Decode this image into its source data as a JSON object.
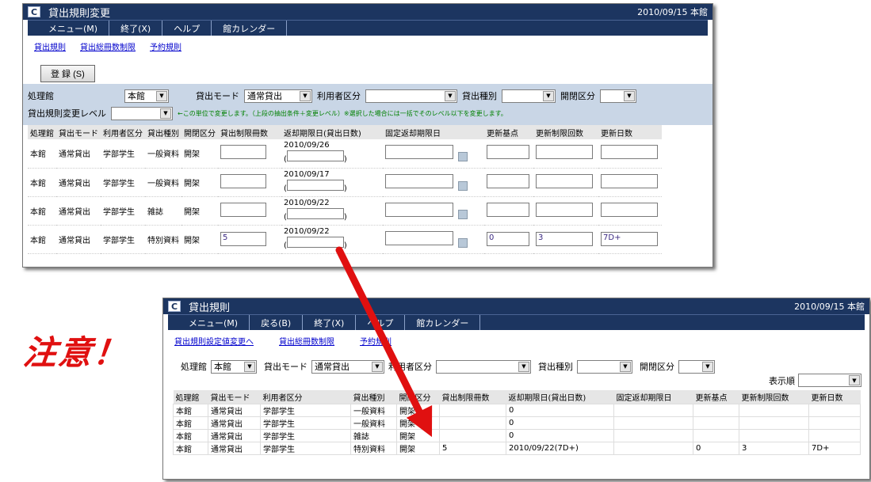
{
  "top": {
    "title": "貸出規則変更",
    "date": "2010/09/15 本館",
    "menu": [
      "メニュー(M)",
      "終了(X)",
      "ヘルプ",
      "館カレンダー"
    ],
    "links": [
      "貸出規則",
      "貸出総冊数制限",
      "予約規則"
    ],
    "register": "登 録 (S)",
    "filters": {
      "proc_label": "処理館",
      "proc_value": "本館",
      "mode_label": "貸出モード",
      "mode_value": "通常貸出",
      "user_label": "利用者区分",
      "user_value": "",
      "type_label": "貸出種別",
      "type_value": "",
      "shelf_label": "開閉区分",
      "shelf_value": "",
      "level_label": "貸出規則変更レベル",
      "level_value": "",
      "note": "←この単位で変更します。（上段の抽出条件＋変更レベル）※選択した場合には一括でそのレベル以下を変更します。"
    },
    "headers": [
      "処理館",
      "貸出モード",
      "利用者区分",
      "貸出種別",
      "開閉区分",
      "貸出制限冊数",
      "返却期限日(貸出日数)",
      "固定返却期限日",
      "更新基点",
      "更新制限回数",
      "更新日数"
    ],
    "rows": [
      {
        "lib": "本館",
        "mode": "通常貸出",
        "user": "学部学生",
        "type": "一般資料",
        "shelf": "開架",
        "limit": "",
        "due": "2010/09/26",
        "fixed": "",
        "base": "",
        "times": "",
        "days": ""
      },
      {
        "lib": "本館",
        "mode": "通常貸出",
        "user": "学部学生",
        "type": "一般資料",
        "shelf": "開架",
        "limit": "",
        "due": "2010/09/17",
        "fixed": "",
        "base": "",
        "times": "",
        "days": ""
      },
      {
        "lib": "本館",
        "mode": "通常貸出",
        "user": "学部学生",
        "type": "雑誌",
        "shelf": "開架",
        "limit": "",
        "due": "2010/09/22",
        "fixed": "",
        "base": "",
        "times": "",
        "days": ""
      },
      {
        "lib": "本館",
        "mode": "通常貸出",
        "user": "学部学生",
        "type": "特別資料",
        "shelf": "開架",
        "limit": "5",
        "due": "2010/09/22",
        "fixed": "",
        "base": "0",
        "times": "3",
        "days": "7D+"
      }
    ]
  },
  "bottom": {
    "title": "貸出規則",
    "date": "2010/09/15 本館",
    "menu": [
      "メニュー(M)",
      "戻る(B)",
      "終了(X)",
      "ヘルプ",
      "館カレンダー"
    ],
    "links": [
      "貸出規則設定値変更へ",
      "貸出総冊数制限",
      "予約規則"
    ],
    "filters": {
      "proc_label": "処理館",
      "proc_value": "本館",
      "mode_label": "貸出モード",
      "mode_value": "通常貸出",
      "user_label": "利用者区分",
      "user_value": "",
      "type_label": "貸出種別",
      "type_value": "",
      "shelf_label": "開閉区分",
      "shelf_value": "",
      "order_label": "表示順",
      "order_value": ""
    },
    "headers": [
      "処理館",
      "貸出モード",
      "利用者区分",
      "貸出種別",
      "開閉区分",
      "貸出制限冊数",
      "返却期限日(貸出日数)",
      "固定返却期限日",
      "更新基点",
      "更新制限回数",
      "更新日数"
    ],
    "rows": [
      {
        "lib": "本館",
        "mode": "通常貸出",
        "user": "学部学生",
        "type": "一般資料",
        "shelf": "開架",
        "limit": "",
        "due": "0",
        "fixed": "",
        "base": "",
        "times": "",
        "days": ""
      },
      {
        "lib": "本館",
        "mode": "通常貸出",
        "user": "学部学生",
        "type": "一般資料",
        "shelf": "開架",
        "limit": "",
        "due": "0",
        "fixed": "",
        "base": "",
        "times": "",
        "days": ""
      },
      {
        "lib": "本館",
        "mode": "通常貸出",
        "user": "学部学生",
        "type": "雑誌",
        "shelf": "開架",
        "limit": "",
        "due": "0",
        "fixed": "",
        "base": "",
        "times": "",
        "days": ""
      },
      {
        "lib": "本館",
        "mode": "通常貸出",
        "user": "学部学生",
        "type": "特別資料",
        "shelf": "開架",
        "limit": "5",
        "due": "2010/09/22(7D+)",
        "fixed": "",
        "base": "0",
        "times": "3",
        "days": "7D+"
      }
    ]
  },
  "annotation": "注意！",
  "colors": {
    "titlebar": "#1c3560",
    "filter_bg": "#c9d6e6",
    "arrow": "#e01010",
    "note": "#008000"
  }
}
